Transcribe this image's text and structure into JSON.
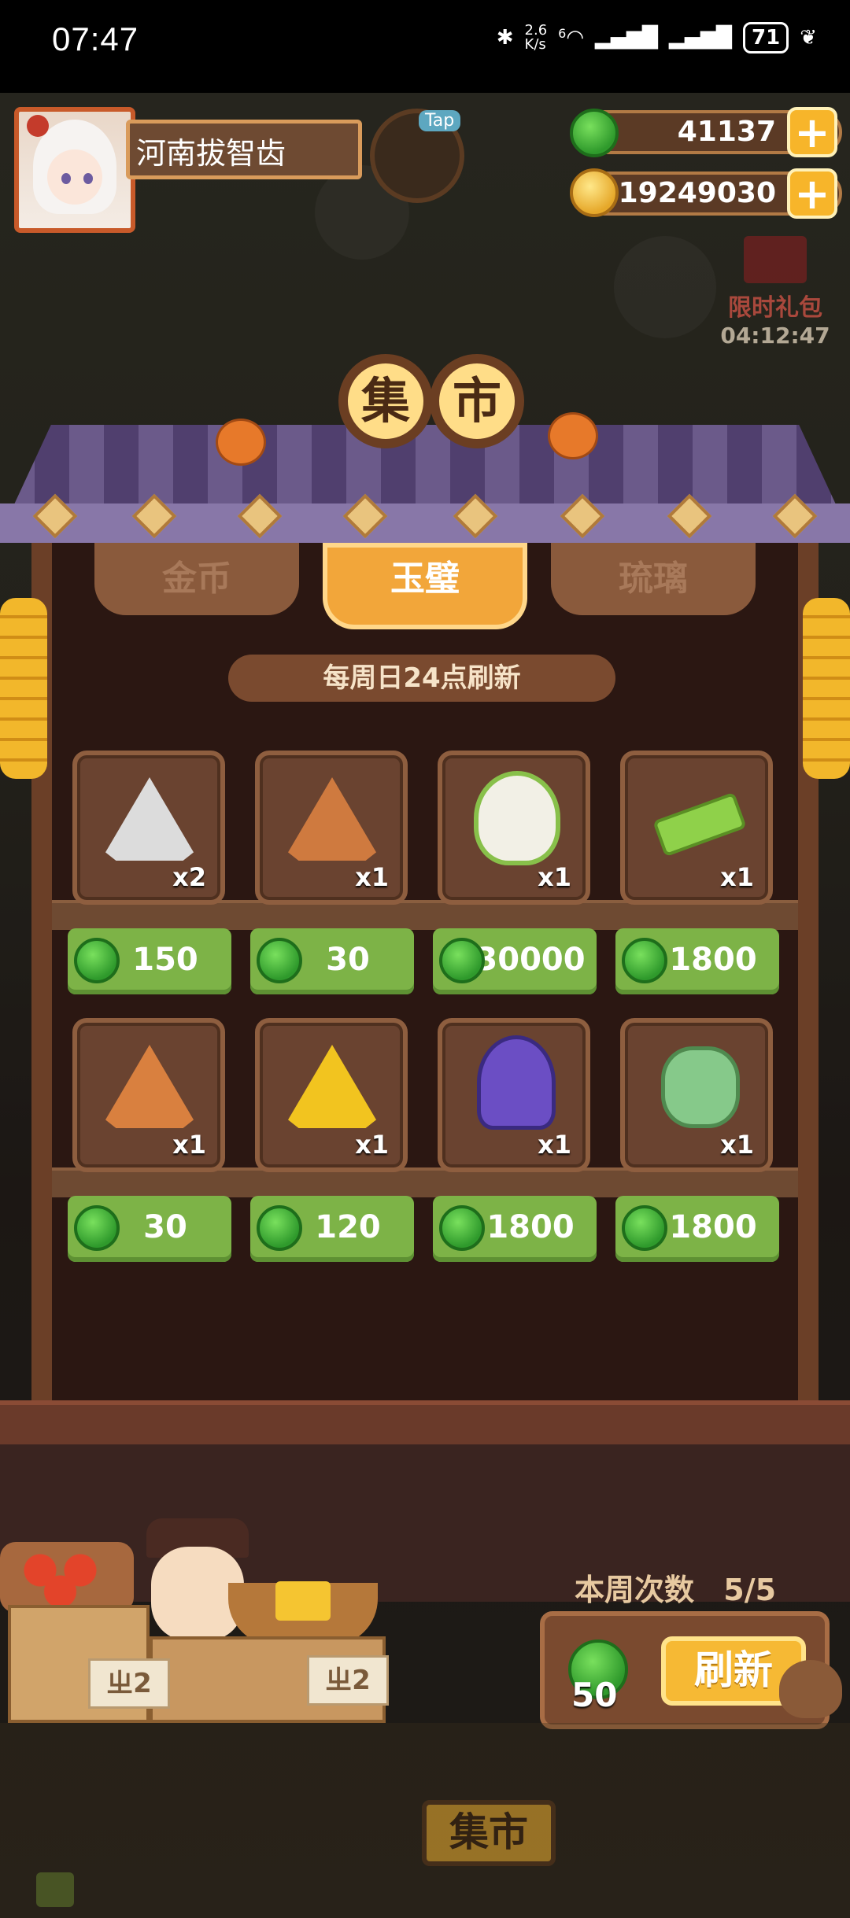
{
  "status_bar": {
    "time": "07:47",
    "net_speed": "2.6\nK/s",
    "network": "6",
    "battery": "71"
  },
  "player": {
    "name": "河南拔智齿"
  },
  "tap_label": "Tap",
  "currencies": {
    "jade": "41137",
    "gold": "19249030"
  },
  "promo": {
    "label": "限时礼包",
    "timer": "04:12:47"
  },
  "market_title": [
    "集",
    "市"
  ],
  "tabs": [
    {
      "label": "金币",
      "active": false
    },
    {
      "label": "玉璧",
      "active": true
    },
    {
      "label": "琉璃",
      "active": false
    }
  ],
  "refresh_note": "每周日24点刷新",
  "items_row1": [
    {
      "icon": "white-spiral-rice-ball",
      "qty": "x2",
      "price": "150",
      "color": "#dcdcdc"
    },
    {
      "icon": "brown-rice-ball",
      "qty": "x1",
      "price": "30",
      "color": "#cf7a3f"
    },
    {
      "icon": "green-hair-character",
      "qty": "x1",
      "price": "30000",
      "color": "#88c04a"
    },
    {
      "icon": "green-jade-slip",
      "qty": "x1",
      "price": "1800",
      "color": "#8fd14a"
    }
  ],
  "items_row2": [
    {
      "icon": "orange-rice-ball",
      "qty": "x1",
      "price": "30",
      "color": "#d9803f"
    },
    {
      "icon": "yellow-spiral-rice-ball",
      "qty": "x1",
      "price": "120",
      "color": "#f2c41f"
    },
    {
      "icon": "purple-cat-mirror",
      "qty": "x1",
      "price": "1800",
      "color": "#6b4ec4"
    },
    {
      "icon": "jade-pendant",
      "qty": "x1",
      "price": "1800",
      "color": "#86c98a"
    }
  ],
  "weekly_count": {
    "label": "本周次数",
    "value": "5/5"
  },
  "refresh": {
    "label": "刷新",
    "cost": "50"
  },
  "crate_labels": [
    "ㄓ2",
    "ㄓ2"
  ],
  "bottom_sign": "集市"
}
